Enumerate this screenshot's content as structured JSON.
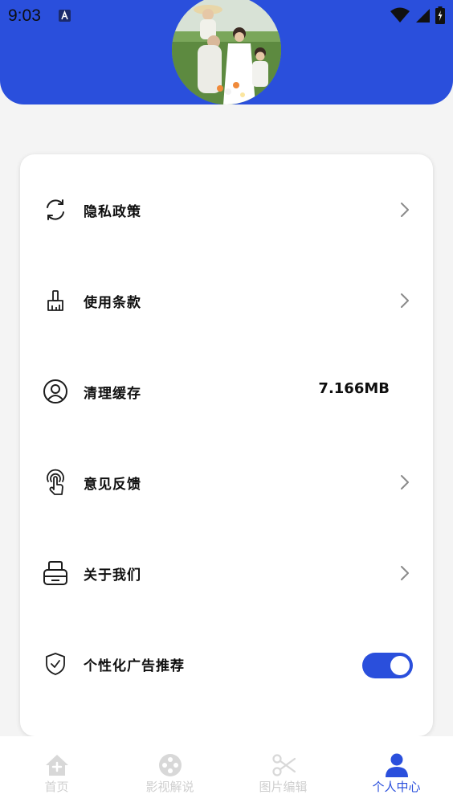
{
  "status_bar": {
    "time": "9:03"
  },
  "menu": {
    "items": [
      {
        "label": "隐私政策",
        "icon": "refresh-icon",
        "has_chevron": true
      },
      {
        "label": "使用条款",
        "icon": "brush-icon",
        "has_chevron": true
      },
      {
        "label": "清理缓存",
        "icon": "user-circle-icon",
        "value": "7.166MB"
      },
      {
        "label": "意见反馈",
        "icon": "touch-icon",
        "has_chevron": true
      },
      {
        "label": "关于我们",
        "icon": "printer-icon",
        "has_chevron": true
      },
      {
        "label": "个性化广告推荐",
        "icon": "shield-check-icon",
        "toggle_on": true
      }
    ]
  },
  "tabbar": {
    "tabs": [
      {
        "label": "首页",
        "icon": "home-icon"
      },
      {
        "label": "影视解说",
        "icon": "film-reel-icon"
      },
      {
        "label": "图片编辑",
        "icon": "scissors-icon"
      },
      {
        "label": "个人中心",
        "icon": "person-icon"
      }
    ],
    "active_index": 3
  },
  "colors": {
    "primary": "#2a4fdc",
    "background": "#f4f4f4",
    "tab_inactive": "#cfcfcf"
  }
}
